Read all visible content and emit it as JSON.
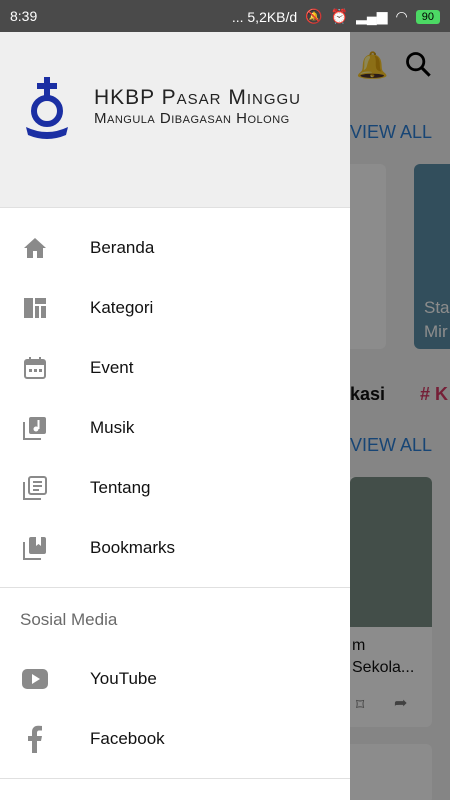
{
  "status": {
    "time": "8:39",
    "network_speed": "... 5,2KB/d",
    "battery": "90"
  },
  "app": {
    "name": "HKBP Pasar Minggu",
    "tagline": "Mangula Dibagasan Holong",
    "logo_text": "HKBP"
  },
  "menu": [
    {
      "label": "Beranda",
      "icon": "home-icon"
    },
    {
      "label": "Kategori",
      "icon": "dashboard-icon"
    },
    {
      "label": "Event",
      "icon": "calendar-icon"
    },
    {
      "label": "Musik",
      "icon": "music-library-icon"
    },
    {
      "label": "Tentang",
      "icon": "library-books-icon"
    },
    {
      "label": "Bookmarks",
      "icon": "bookmarks-icon"
    }
  ],
  "social": {
    "title": "Sosial Media",
    "items": [
      {
        "label": "YouTube",
        "icon": "youtube-icon"
      },
      {
        "label": "Facebook",
        "icon": "facebook-icon"
      }
    ]
  },
  "background": {
    "view_all_1": "VIEW ALL",
    "view_all_2": "VIEW ALL",
    "card_text_1": "Sta",
    "card_text_2": "Mir",
    "tag_1": "kasi",
    "tag_2": "# K",
    "card_title_1": "m",
    "card_title_2": "Sekola..."
  },
  "colors": {
    "accent": "#2b7fd6",
    "logo_blue": "#1b2fa3"
  }
}
